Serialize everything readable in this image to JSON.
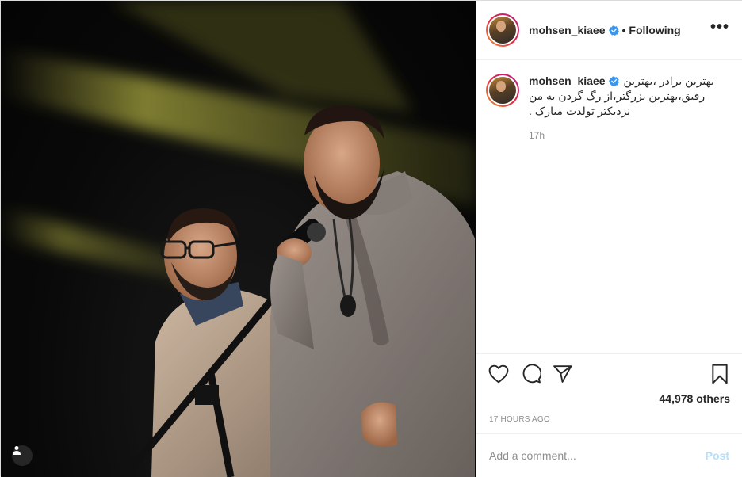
{
  "post": {
    "username": "mohsen_kiaee",
    "follow_state": "Following",
    "separator": "•",
    "more_label": "•••"
  },
  "caption": {
    "username": "mohsen_kiaee",
    "line1": "بهترین برادر ،بهترین",
    "line2": "رفیق،بهترین بزرگتر،از رگ گردن به من",
    "line3": "نزدیکتر تولدت مبارک .",
    "time": "17h"
  },
  "engagement": {
    "likes_text": "44,978 others",
    "time_ago": "17 HOURS AGO"
  },
  "comment": {
    "placeholder": "Add a comment...",
    "post_label": "Post"
  },
  "icons": {
    "like": "heart-icon",
    "comment": "comment-icon",
    "share": "share-icon",
    "save": "bookmark-icon",
    "verified": "verified-badge-icon",
    "tag": "user-tag-icon"
  },
  "colors": {
    "verified_blue": "#3897f0",
    "post_button_disabled": "#b2dffc",
    "stage_light": "#c8c64a",
    "border": "#efefef"
  }
}
